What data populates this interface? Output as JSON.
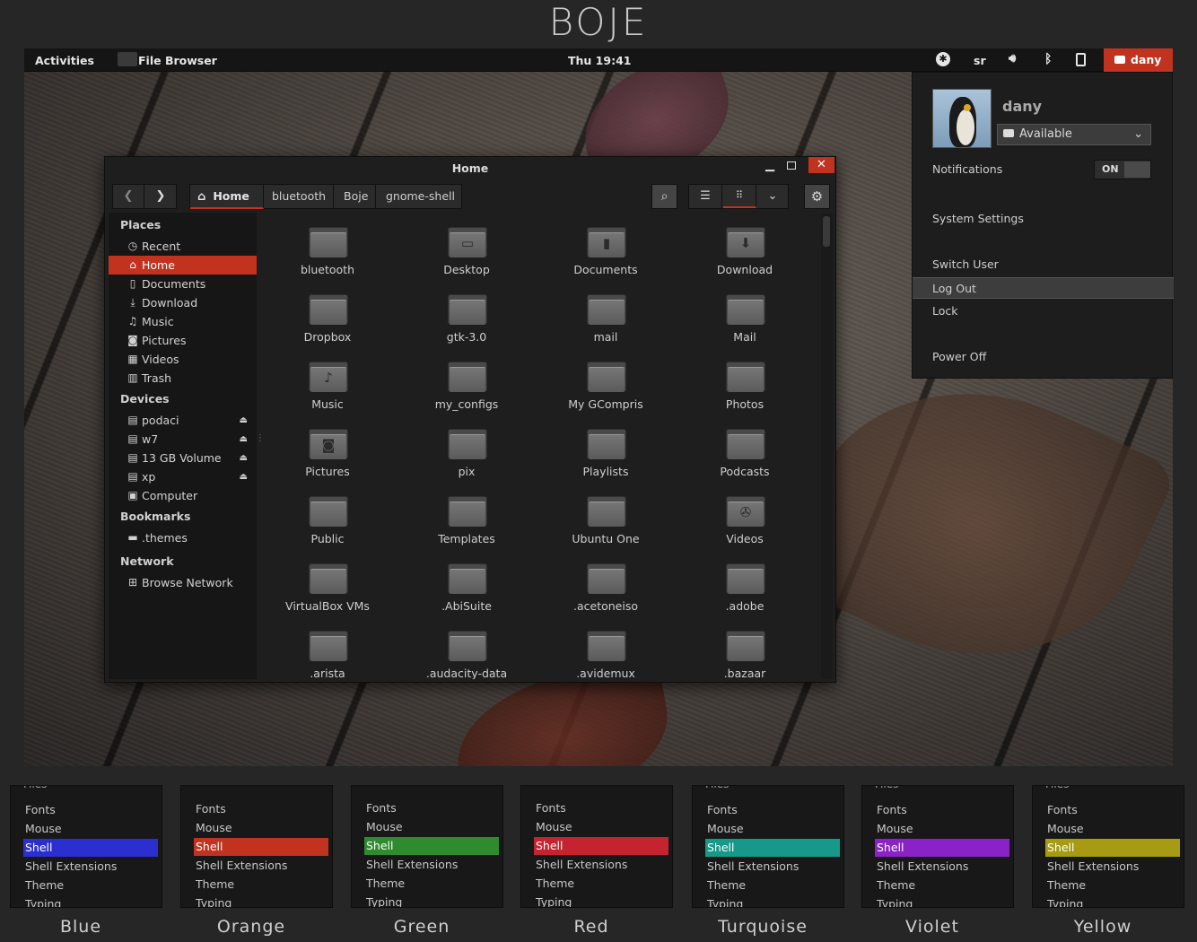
{
  "brand": "BOJE",
  "topbar": {
    "activities": "Activities",
    "app": "File Browser",
    "clock": "Thu 19:41",
    "keyboard": "sr",
    "user": "dany",
    "icons": [
      "accessibility-icon",
      "volume-icon",
      "bluetooth-icon",
      "battery-icon",
      "chat-icon"
    ]
  },
  "window": {
    "title": "Home",
    "path": [
      "Home",
      "bluetooth",
      "Boje",
      "gnome-shell"
    ],
    "sidebar": {
      "places_header": "Places",
      "places": [
        {
          "label": "Recent",
          "icon": "clock-icon"
        },
        {
          "label": "Home",
          "icon": "home-icon"
        },
        {
          "label": "Documents",
          "icon": "document-icon"
        },
        {
          "label": "Download",
          "icon": "download-icon"
        },
        {
          "label": "Music",
          "icon": "music-icon"
        },
        {
          "label": "Pictures",
          "icon": "camera-icon"
        },
        {
          "label": "Videos",
          "icon": "film-icon"
        },
        {
          "label": "Trash",
          "icon": "trash-icon"
        }
      ],
      "devices_header": "Devices",
      "devices": [
        {
          "label": "podaci",
          "icon": "drive-icon"
        },
        {
          "label": "w7",
          "icon": "drive-icon"
        },
        {
          "label": "13 GB Volume",
          "icon": "drive-icon"
        },
        {
          "label": "xp",
          "icon": "drive-icon"
        },
        {
          "label": "Computer",
          "icon": "computer-icon"
        }
      ],
      "bookmarks_header": "Bookmarks",
      "bookmarks": [
        {
          "label": ".themes",
          "icon": "folder-icon"
        }
      ],
      "network_header": "Network",
      "network": [
        {
          "label": "Browse Network",
          "icon": "network-icon"
        }
      ]
    },
    "files": [
      {
        "name": "bluetooth",
        "emblem": ""
      },
      {
        "name": "Desktop",
        "emblem": "desktop"
      },
      {
        "name": "Documents",
        "emblem": "doc"
      },
      {
        "name": "Download",
        "emblem": "down"
      },
      {
        "name": "Dropbox",
        "emblem": ""
      },
      {
        "name": "gtk-3.0",
        "emblem": ""
      },
      {
        "name": "mail",
        "emblem": ""
      },
      {
        "name": "Mail",
        "emblem": ""
      },
      {
        "name": "Music",
        "emblem": "music"
      },
      {
        "name": "my_configs",
        "emblem": ""
      },
      {
        "name": "My GCompris",
        "emblem": ""
      },
      {
        "name": "Photos",
        "emblem": ""
      },
      {
        "name": "Pictures",
        "emblem": "camera"
      },
      {
        "name": "pix",
        "emblem": ""
      },
      {
        "name": "Playlists",
        "emblem": ""
      },
      {
        "name": "Podcasts",
        "emblem": ""
      },
      {
        "name": "Public",
        "emblem": ""
      },
      {
        "name": "Templates",
        "emblem": ""
      },
      {
        "name": "Ubuntu One",
        "emblem": ""
      },
      {
        "name": "Videos",
        "emblem": "video"
      },
      {
        "name": "VirtualBox VMs",
        "emblem": ""
      },
      {
        "name": ".AbiSuite",
        "emblem": ""
      },
      {
        "name": ".acetoneiso",
        "emblem": ""
      },
      {
        "name": ".adobe",
        "emblem": ""
      },
      {
        "name": ".arista",
        "emblem": ""
      },
      {
        "name": ".audacity-data",
        "emblem": ""
      },
      {
        "name": ".avidemux",
        "emblem": ""
      },
      {
        "name": ".bazaar",
        "emblem": ""
      }
    ]
  },
  "user_menu": {
    "name": "dany",
    "status": "Available",
    "notifications_label": "Notifications",
    "notifications_state": "ON",
    "system_settings": "System Settings",
    "switch_user": "Switch User",
    "log_out": "Log Out",
    "lock": "Lock",
    "power_off": "Power Off"
  },
  "swatches": [
    {
      "name": "Blue",
      "color": "#2b2fcf",
      "rows": [
        "Fonts",
        "Mouse",
        "Shell",
        "Shell Extensions",
        "Theme",
        "Typing"
      ],
      "cut": "Files"
    },
    {
      "name": "Orange",
      "color": "#c1331f",
      "rows": [
        "Fonts",
        "Mouse",
        "Shell",
        "Shell Extensions",
        "Theme",
        "Typing"
      ],
      "cut": ""
    },
    {
      "name": "Green",
      "color": "#2e8b2e",
      "rows": [
        "Fonts",
        "Mouse",
        "Shell",
        "Shell Extensions",
        "Theme",
        "Typing"
      ],
      "cut": ""
    },
    {
      "name": "Red",
      "color": "#c4232f",
      "rows": [
        "Fonts",
        "Mouse",
        "Shell",
        "Shell Extensions",
        "Theme",
        "Typing"
      ],
      "cut": ""
    },
    {
      "name": "Turquoise",
      "color": "#16998a",
      "rows": [
        "Fonts",
        "Mouse",
        "Shell",
        "Shell Extensions",
        "Theme",
        "Typing"
      ],
      "cut": "Files"
    },
    {
      "name": "Violet",
      "color": "#8a22c7",
      "rows": [
        "Fonts",
        "Mouse",
        "Shell",
        "Shell Extensions",
        "Theme",
        "Typing"
      ],
      "cut": "Files"
    },
    {
      "name": "Yellow",
      "color": "#a69b12",
      "rows": [
        "Fonts",
        "Mouse",
        "Shell",
        "Shell Extensions",
        "Theme",
        "Typing"
      ],
      "cut": "Files"
    }
  ],
  "accent": "#c1331f"
}
